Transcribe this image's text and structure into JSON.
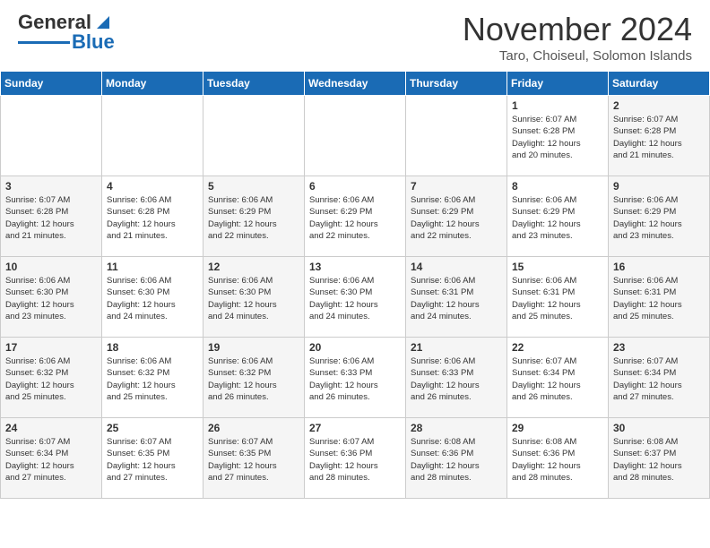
{
  "header": {
    "logo_general": "General",
    "logo_blue": "Blue",
    "month_title": "November 2024",
    "subtitle": "Taro, Choiseul, Solomon Islands"
  },
  "days_of_week": [
    "Sunday",
    "Monday",
    "Tuesday",
    "Wednesday",
    "Thursday",
    "Friday",
    "Saturday"
  ],
  "weeks": [
    {
      "days": [
        {
          "num": "",
          "info": ""
        },
        {
          "num": "",
          "info": ""
        },
        {
          "num": "",
          "info": ""
        },
        {
          "num": "",
          "info": ""
        },
        {
          "num": "",
          "info": ""
        },
        {
          "num": "1",
          "info": "Sunrise: 6:07 AM\nSunset: 6:28 PM\nDaylight: 12 hours\nand 20 minutes."
        },
        {
          "num": "2",
          "info": "Sunrise: 6:07 AM\nSunset: 6:28 PM\nDaylight: 12 hours\nand 21 minutes."
        }
      ]
    },
    {
      "days": [
        {
          "num": "3",
          "info": "Sunrise: 6:07 AM\nSunset: 6:28 PM\nDaylight: 12 hours\nand 21 minutes."
        },
        {
          "num": "4",
          "info": "Sunrise: 6:06 AM\nSunset: 6:28 PM\nDaylight: 12 hours\nand 21 minutes."
        },
        {
          "num": "5",
          "info": "Sunrise: 6:06 AM\nSunset: 6:29 PM\nDaylight: 12 hours\nand 22 minutes."
        },
        {
          "num": "6",
          "info": "Sunrise: 6:06 AM\nSunset: 6:29 PM\nDaylight: 12 hours\nand 22 minutes."
        },
        {
          "num": "7",
          "info": "Sunrise: 6:06 AM\nSunset: 6:29 PM\nDaylight: 12 hours\nand 22 minutes."
        },
        {
          "num": "8",
          "info": "Sunrise: 6:06 AM\nSunset: 6:29 PM\nDaylight: 12 hours\nand 23 minutes."
        },
        {
          "num": "9",
          "info": "Sunrise: 6:06 AM\nSunset: 6:29 PM\nDaylight: 12 hours\nand 23 minutes."
        }
      ]
    },
    {
      "days": [
        {
          "num": "10",
          "info": "Sunrise: 6:06 AM\nSunset: 6:30 PM\nDaylight: 12 hours\nand 23 minutes."
        },
        {
          "num": "11",
          "info": "Sunrise: 6:06 AM\nSunset: 6:30 PM\nDaylight: 12 hours\nand 24 minutes."
        },
        {
          "num": "12",
          "info": "Sunrise: 6:06 AM\nSunset: 6:30 PM\nDaylight: 12 hours\nand 24 minutes."
        },
        {
          "num": "13",
          "info": "Sunrise: 6:06 AM\nSunset: 6:30 PM\nDaylight: 12 hours\nand 24 minutes."
        },
        {
          "num": "14",
          "info": "Sunrise: 6:06 AM\nSunset: 6:31 PM\nDaylight: 12 hours\nand 24 minutes."
        },
        {
          "num": "15",
          "info": "Sunrise: 6:06 AM\nSunset: 6:31 PM\nDaylight: 12 hours\nand 25 minutes."
        },
        {
          "num": "16",
          "info": "Sunrise: 6:06 AM\nSunset: 6:31 PM\nDaylight: 12 hours\nand 25 minutes."
        }
      ]
    },
    {
      "days": [
        {
          "num": "17",
          "info": "Sunrise: 6:06 AM\nSunset: 6:32 PM\nDaylight: 12 hours\nand 25 minutes."
        },
        {
          "num": "18",
          "info": "Sunrise: 6:06 AM\nSunset: 6:32 PM\nDaylight: 12 hours\nand 25 minutes."
        },
        {
          "num": "19",
          "info": "Sunrise: 6:06 AM\nSunset: 6:32 PM\nDaylight: 12 hours\nand 26 minutes."
        },
        {
          "num": "20",
          "info": "Sunrise: 6:06 AM\nSunset: 6:33 PM\nDaylight: 12 hours\nand 26 minutes."
        },
        {
          "num": "21",
          "info": "Sunrise: 6:06 AM\nSunset: 6:33 PM\nDaylight: 12 hours\nand 26 minutes."
        },
        {
          "num": "22",
          "info": "Sunrise: 6:07 AM\nSunset: 6:34 PM\nDaylight: 12 hours\nand 26 minutes."
        },
        {
          "num": "23",
          "info": "Sunrise: 6:07 AM\nSunset: 6:34 PM\nDaylight: 12 hours\nand 27 minutes."
        }
      ]
    },
    {
      "days": [
        {
          "num": "24",
          "info": "Sunrise: 6:07 AM\nSunset: 6:34 PM\nDaylight: 12 hours\nand 27 minutes."
        },
        {
          "num": "25",
          "info": "Sunrise: 6:07 AM\nSunset: 6:35 PM\nDaylight: 12 hours\nand 27 minutes."
        },
        {
          "num": "26",
          "info": "Sunrise: 6:07 AM\nSunset: 6:35 PM\nDaylight: 12 hours\nand 27 minutes."
        },
        {
          "num": "27",
          "info": "Sunrise: 6:07 AM\nSunset: 6:36 PM\nDaylight: 12 hours\nand 28 minutes."
        },
        {
          "num": "28",
          "info": "Sunrise: 6:08 AM\nSunset: 6:36 PM\nDaylight: 12 hours\nand 28 minutes."
        },
        {
          "num": "29",
          "info": "Sunrise: 6:08 AM\nSunset: 6:36 PM\nDaylight: 12 hours\nand 28 minutes."
        },
        {
          "num": "30",
          "info": "Sunrise: 6:08 AM\nSunset: 6:37 PM\nDaylight: 12 hours\nand 28 minutes."
        }
      ]
    }
  ]
}
